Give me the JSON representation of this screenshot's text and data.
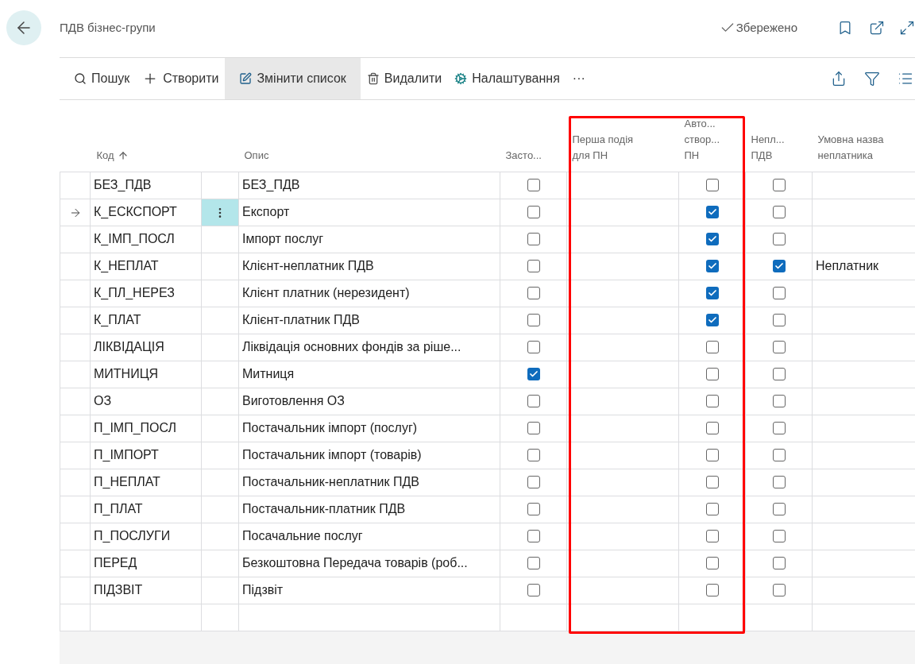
{
  "page": {
    "title": "ПДВ бізнес-групи",
    "save_status": "Збережено"
  },
  "actions": [
    {
      "kind": "search",
      "label": "Пошук",
      "selected": false
    },
    {
      "kind": "new",
      "label": "Створити",
      "selected": false
    },
    {
      "kind": "edit",
      "label": "Змінити список",
      "selected": true
    },
    {
      "kind": "delete",
      "label": "Видалити",
      "selected": false
    },
    {
      "kind": "settings",
      "label": "Налаштування",
      "selected": false
    },
    {
      "kind": "more",
      "label": "···",
      "selected": false
    }
  ],
  "table": {
    "columns": [
      {
        "kind": "code",
        "lines": [
          "Код"
        ],
        "sorted": true
      },
      {
        "kind": "description",
        "lines": [
          "Опис"
        ],
        "sorted": false
      },
      {
        "kind": "applied",
        "lines": [
          "Засто..."
        ],
        "sorted": false
      },
      {
        "kind": "first_event",
        "lines": [
          "Перша подія",
          "для ПН"
        ],
        "sorted": false
      },
      {
        "kind": "auto_create",
        "lines": [
          "Авто...",
          "створ...",
          "ПН"
        ],
        "sorted": false
      },
      {
        "kind": "non_payer",
        "lines": [
          "Непл...",
          "ПДВ"
        ],
        "sorted": false
      },
      {
        "kind": "non_payer_name",
        "lines": [
          "Умовна назва",
          "неплатника"
        ],
        "sorted": false
      }
    ],
    "rows": [
      {
        "code": "БЕЗ_ПДВ",
        "description": "БЕЗ_ПДВ",
        "applied": false,
        "auto_create": false,
        "non_payer": false,
        "selected": false
      },
      {
        "code": "К_ЕСКСПОРТ",
        "description": "Експорт",
        "applied": false,
        "auto_create": true,
        "non_payer": false,
        "selected": true
      },
      {
        "code": "К_ІМП_ПОСЛ",
        "description": "Імпорт послуг",
        "applied": false,
        "auto_create": true,
        "non_payer": false,
        "selected": false
      },
      {
        "code": "К_НЕПЛАТ",
        "description": "Клієнт-неплатник ПДВ",
        "applied": false,
        "auto_create": true,
        "non_payer": true,
        "non_payer_name": "Неплатник",
        "selected": false
      },
      {
        "code": "К_ПЛ_НЕРЕЗ",
        "description": "Клієнт платник (нерезидент)",
        "applied": false,
        "auto_create": true,
        "non_payer": false,
        "selected": false
      },
      {
        "code": "К_ПЛАТ",
        "description": "Клієнт-платник ПДВ",
        "applied": false,
        "auto_create": true,
        "non_payer": false,
        "selected": false
      },
      {
        "code": "ЛІКВІДАЦІЯ",
        "description": "Ліквідація основних фондів за ріше...",
        "applied": false,
        "auto_create": false,
        "non_payer": false,
        "selected": false
      },
      {
        "code": "МИТНИЦЯ",
        "description": "Митниця",
        "applied": true,
        "auto_create": false,
        "non_payer": false,
        "selected": false
      },
      {
        "code": "ОЗ",
        "description": "Виготовлення ОЗ",
        "applied": false,
        "auto_create": false,
        "non_payer": false,
        "selected": false
      },
      {
        "code": "П_ІМП_ПОСЛ",
        "description": "Постачальник імпорт (послуг)",
        "applied": false,
        "auto_create": false,
        "non_payer": false,
        "selected": false
      },
      {
        "code": "П_ІМПОРТ",
        "description": "Постачальник імпорт (товарів)",
        "applied": false,
        "auto_create": false,
        "non_payer": false,
        "selected": false
      },
      {
        "code": "П_НЕПЛАТ",
        "description": "Постачальник-неплатник ПДВ",
        "applied": false,
        "auto_create": false,
        "non_payer": false,
        "selected": false
      },
      {
        "code": "П_ПЛАТ",
        "description": "Постачальник-платник ПДВ",
        "applied": false,
        "auto_create": false,
        "non_payer": false,
        "selected": false
      },
      {
        "code": "П_ПОСЛУГИ",
        "description": "Посачальние послуг",
        "applied": false,
        "auto_create": false,
        "non_payer": false,
        "selected": false
      },
      {
        "code": "ПЕРЕД",
        "description": "Безкоштовна Передача товарів (роб...",
        "applied": false,
        "auto_create": false,
        "non_payer": false,
        "selected": false
      },
      {
        "code": "ПІДЗВІТ",
        "description": "Підзвіт",
        "applied": false,
        "auto_create": false,
        "non_payer": false,
        "selected": false
      }
    ]
  }
}
